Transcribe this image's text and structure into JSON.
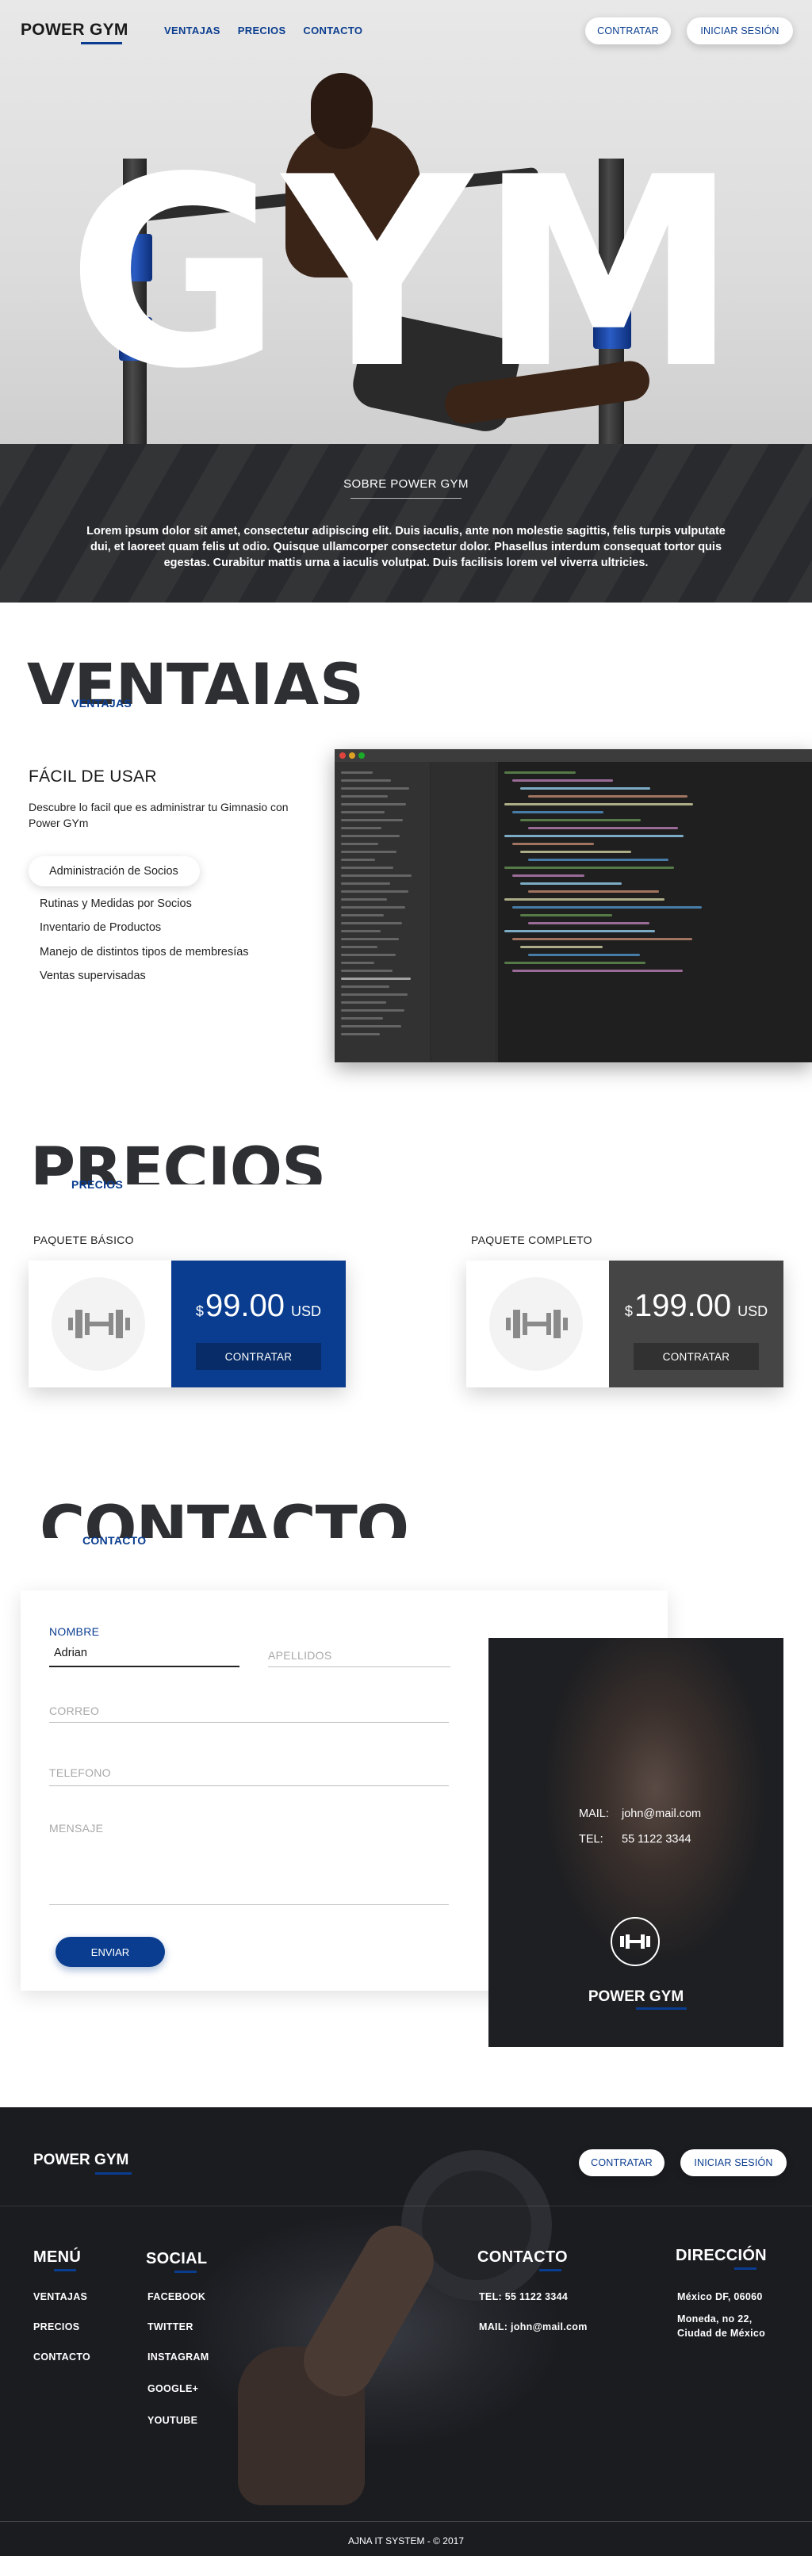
{
  "header": {
    "brand": "POWER GYM",
    "nav": [
      "VENTAJAS",
      "PRECIOS",
      "CONTACTO"
    ],
    "contratar": "CONTRATAR",
    "iniciar_sesion": "INICIAR SESIÓN"
  },
  "hero": {
    "word": "GYM"
  },
  "about": {
    "title": "SOBRE POWER GYM",
    "text": "Lorem ipsum dolor sit amet, consectetur adipiscing elit. Duis iaculis, ante non molestie sagittis, felis turpis vulputate dui, et laoreet quam felis ut odio. Quisque ullamcorper consectetur dolor. Phasellus interdum consequat tortor quis egestas. Curabitur mattis urna a iaculis volutpat. Duis facilisis lorem vel viverra ultricies."
  },
  "ventajas": {
    "big": "VENTAJAS",
    "small": "VENTAJAS",
    "feature_title": "FÁCIL DE USAR",
    "feature_desc": "Descubre lo facil que es administrar tu Gimnasio con Power GYm",
    "items": [
      "Administración de Socios",
      "Rutinas y Medidas por Socios",
      "Inventario de Productos",
      "Manejo de distintos tipos de membresías",
      "Ventas supervisadas"
    ]
  },
  "precios": {
    "big": "PRECIOS",
    "small": "PRECIOS",
    "packages": [
      {
        "label": "PAQUETE BÁSICO",
        "currency": "$",
        "amount": "99.00",
        "unit": "USD",
        "button": "CONTRATAR",
        "color": "#0a3d8f"
      },
      {
        "label": "PAQUETE COMPLETO",
        "currency": "$",
        "amount": "199.00",
        "unit": "USD",
        "button": "CONTRATAR",
        "color": "#454545"
      }
    ]
  },
  "contacto": {
    "big": "CONTACTO",
    "small": "CONTACTO",
    "form": {
      "nombre_label": "NOMBRE",
      "nombre_value": "Adrian",
      "apellidos": "APELLIDOS",
      "correo": "CORREO",
      "telefono": "TELEFONO",
      "mensaje": "MENSAJE",
      "enviar": "ENVIAR"
    },
    "info": {
      "mail_label": "MAIL:",
      "mail": "john@mail.com",
      "tel_label": "TEL:",
      "tel": "55 1122 3344",
      "brand": "POWER GYM"
    }
  },
  "footer": {
    "brand": "POWER GYM",
    "contratar": "CONTRATAR",
    "iniciar_sesion": "INICIAR SESIÓN",
    "menu_title": "MENÚ",
    "menu": [
      "VENTAJAS",
      "PRECIOS",
      "CONTACTO"
    ],
    "social_title": "SOCIAL",
    "social": [
      "FACEBOOK",
      "TWITTER",
      "INSTAGRAM",
      "GOOGLE+",
      "YOUTUBE"
    ],
    "contact_title": "CONTACTO",
    "contact_tel": "TEL: 55 1122 3344",
    "contact_mail": "MAIL: john@mail.com",
    "address_title": "DIRECCIÓN",
    "address_line1": "México DF, 06060",
    "address_line2": "Moneda, no 22, Ciudad de México",
    "copyright": "AJNA IT SYSTEM - © 2017"
  },
  "colors": {
    "accent": "#0a3d8f",
    "dark": "#2b2d30",
    "premium": "#454545"
  }
}
